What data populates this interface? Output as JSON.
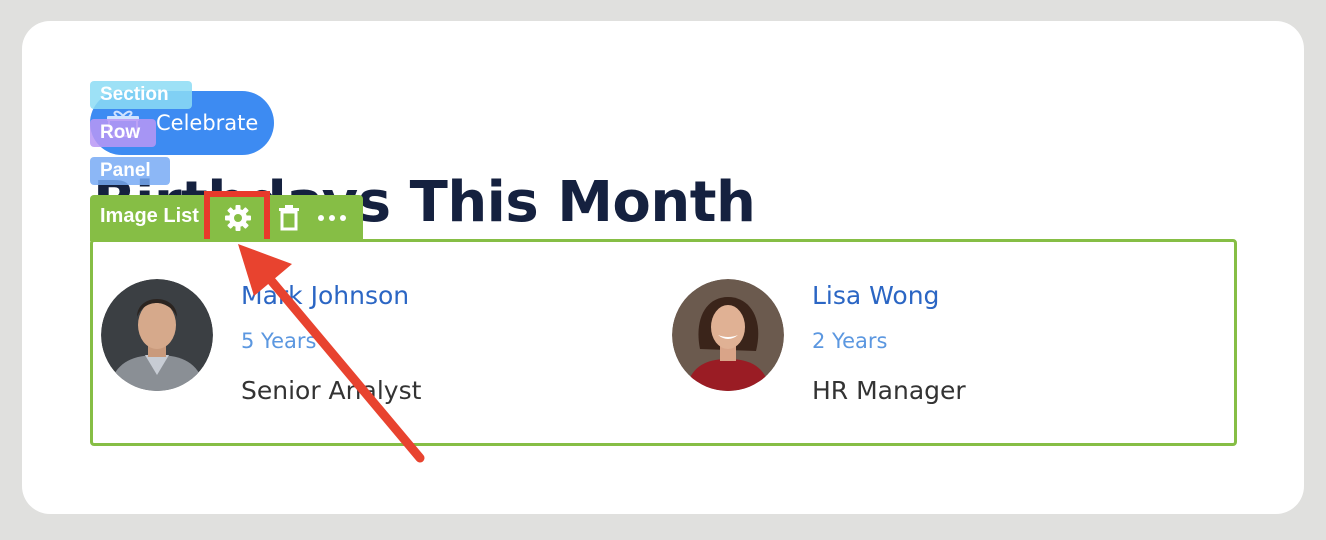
{
  "celebrate": {
    "label": "Celebrate",
    "icon": "gift-icon"
  },
  "tags": {
    "section": "Section",
    "row": "Row",
    "panel": "Panel"
  },
  "heading": "Birthdays This Month",
  "toolbar": {
    "label": "Image List",
    "settings_icon": "gear-icon",
    "delete_icon": "trash-icon",
    "more_icon": "more-icon"
  },
  "people": [
    {
      "name": "Mark Johnson",
      "years": "5 Years",
      "role": "Senior Analyst"
    },
    {
      "name": "Lisa Wong",
      "years": "2 Years",
      "role": "HR Manager"
    }
  ],
  "colors": {
    "accent_green": "#86be45",
    "highlight_red": "#e8392b",
    "button_blue": "#3d8bf2",
    "heading": "#15213f"
  }
}
